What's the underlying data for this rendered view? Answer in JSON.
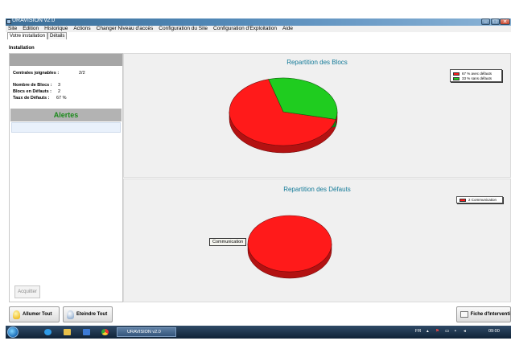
{
  "window": {
    "title": "URAVISION v2.0"
  },
  "menu": [
    "Site",
    "Edition",
    "Historique",
    "Actions",
    "Changer Niveau d'accès",
    "Configuration du Site",
    "Configuration d'Exploitation",
    "Aide"
  ],
  "tabs": [
    {
      "label": "Votre installation",
      "active": true
    },
    {
      "label": "Détails",
      "active": false
    }
  ],
  "installation_label": "Installation",
  "info": {
    "centrales_label": "Centrales joignables :",
    "centrales_value": "2/2",
    "nb_blocs_label": "Nombre de Blocs :",
    "nb_blocs_value": "3",
    "blocs_defauts_label": "Blocs en Défauts :",
    "blocs_defauts_value": "2",
    "taux_label": "Taux de Défauts :",
    "taux_value": "67 %"
  },
  "alertes_title": "Alertes",
  "acquitter_label": "Acquitter",
  "chart_data": [
    {
      "type": "pie",
      "title": "Repartition des Blocs",
      "labels": [
        "67 % avec défauts",
        "33 % sans défauts"
      ],
      "values": [
        67,
        33
      ],
      "colors": [
        "#ff1a1a",
        "#1fcc1f"
      ],
      "legend": "top-right"
    },
    {
      "type": "pie",
      "title": "Repartition des Défauts",
      "labels": [
        "2 Communication"
      ],
      "values": [
        2
      ],
      "colors": [
        "#ff1a1a"
      ],
      "legend": "top-right"
    }
  ],
  "tooltip_label": "Communication",
  "buttons": {
    "allumer": "Allumer Tout",
    "eteindre": "Eteindre Tout",
    "fiche": "Fiche d'Interventi"
  },
  "taskbar": {
    "task_label": "URAVISION v2.0",
    "lang": "FR",
    "clock": "09:00"
  },
  "colors": {
    "accent_teal": "#137a98",
    "alertes_green": "#1b8a1b",
    "pie_red": "#ff1a1a",
    "pie_green": "#1fcc1f"
  },
  "icons": [
    "app-icon",
    "minimize-icon",
    "maximize-icon",
    "close-icon",
    "bulb-on-icon",
    "bulb-off-icon",
    "document-icon",
    "windows-start-icon",
    "ie-icon",
    "folder-icon",
    "media-player-icon",
    "chrome-icon",
    "network-icon",
    "flag-icon",
    "volume-icon"
  ]
}
